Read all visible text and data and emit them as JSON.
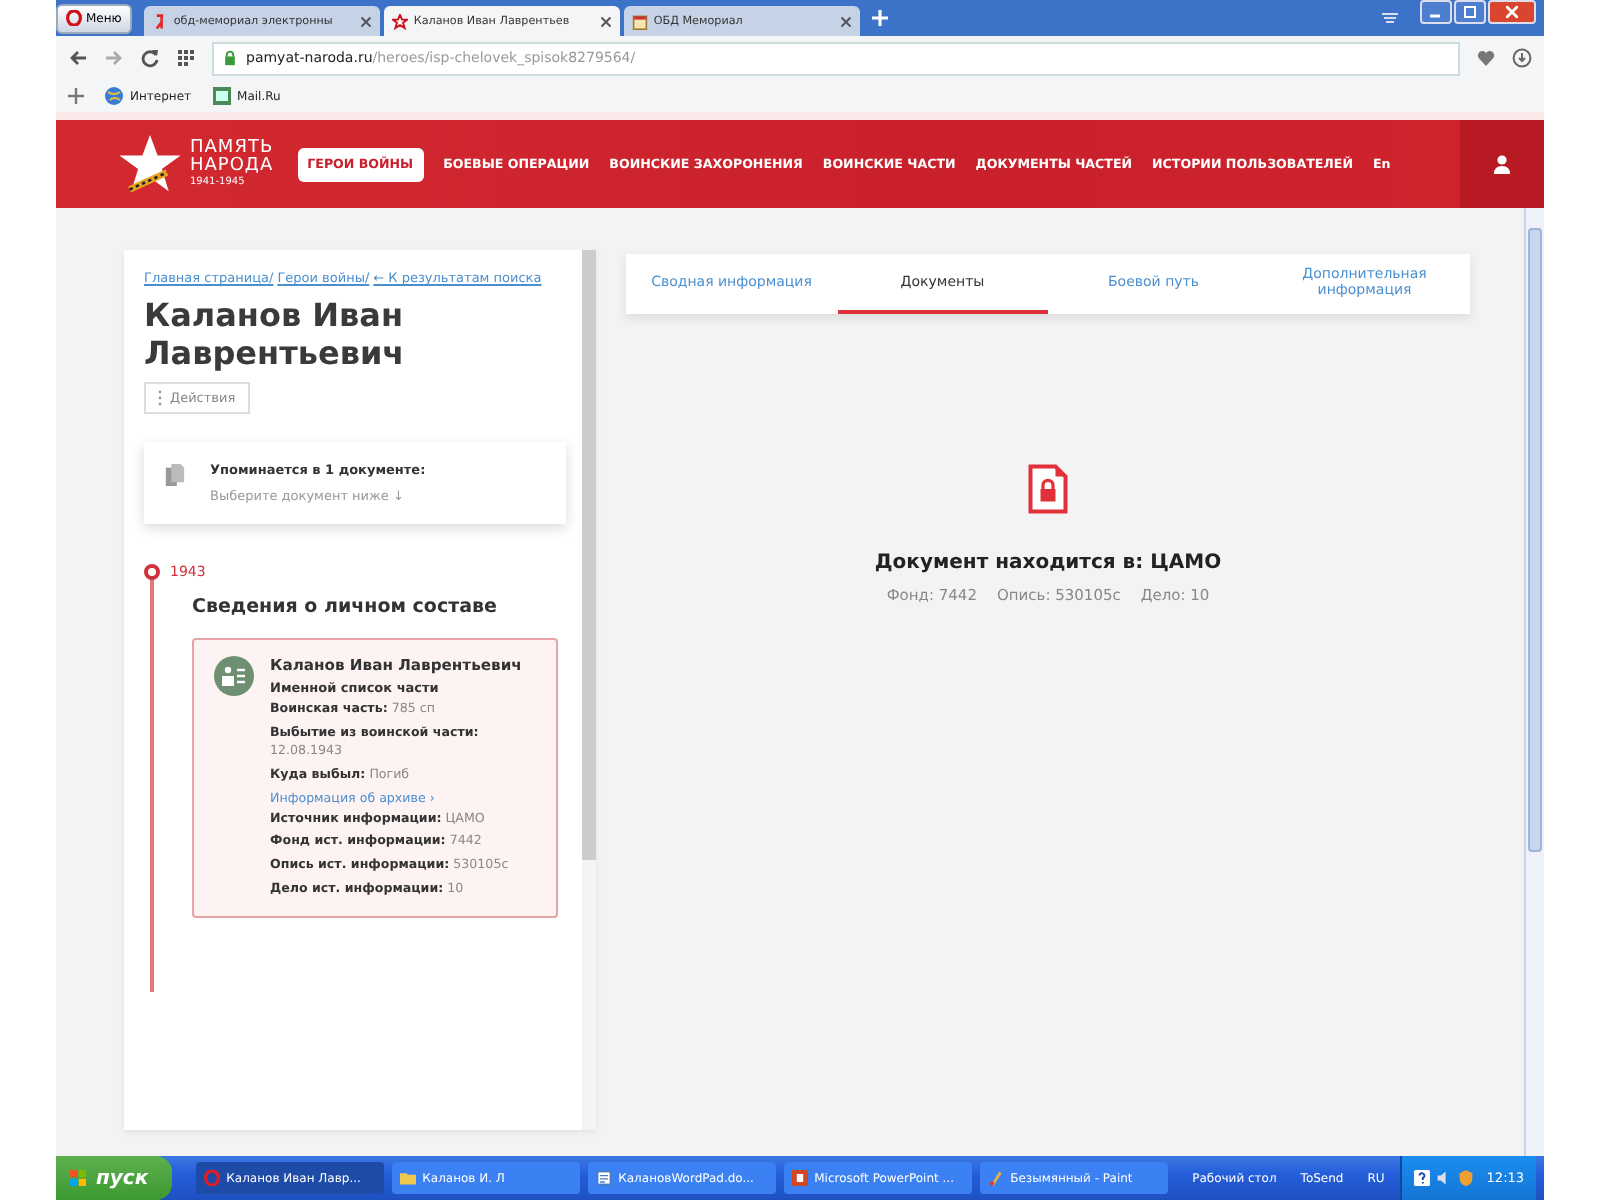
{
  "browser": {
    "menu_label": "Меню",
    "tabs": [
      {
        "title": "обд-мемориал электронны",
        "selected": false
      },
      {
        "title": "Каланов Иван Лаврентьев",
        "selected": true
      },
      {
        "title": "ОБД Мемориал",
        "selected": false
      }
    ],
    "url_host": "pamyat-naroda.ru",
    "url_path": "/heroes/isp-chelovek_spisok8279564/",
    "bookmarks": [
      {
        "label": "Интернет"
      },
      {
        "label": "Mail.Ru"
      }
    ]
  },
  "site_header": {
    "logo": [
      "ПАМЯТЬ",
      "НАРОДА",
      "1941-1945"
    ],
    "nav": [
      {
        "label": "ГЕРОИ ВОЙНЫ",
        "selected": true
      },
      {
        "label": "БОЕВЫЕ ОПЕРАЦИИ",
        "selected": false
      },
      {
        "label": "ВОИНСКИЕ ЗАХОРОНЕНИЯ",
        "selected": false
      },
      {
        "label": "ВОИНСКИЕ ЧАСТИ",
        "selected": false
      },
      {
        "label": "ДОКУМЕНТЫ ЧАСТЕЙ",
        "selected": false
      },
      {
        "label": "ИСТОРИИ ПОЛЬЗОВАТЕЛЕЙ",
        "selected": false
      }
    ],
    "language": "En"
  },
  "person": {
    "breadcrumbs": [
      "Главная страница/",
      "Герои войны/",
      "← К результатам поиска"
    ],
    "name": "Каланов Иван Лаврентьевич",
    "actions": "Действия",
    "mention": {
      "title": "Упоминается в 1 документе:",
      "hint": "Выберите документ ниже ↓"
    },
    "timeline": {
      "year": "1943",
      "section": "Сведения о личном составе",
      "record": {
        "name": "Каланов Иван Лаврентьевич",
        "type": "Именной список части",
        "fields": [
          {
            "kind": "field",
            "label": "Воинская часть:",
            "value": "785 сп"
          },
          {
            "kind": "field",
            "label": "Выбытие из воинской части:",
            "value": "12.08.1943"
          },
          {
            "kind": "field",
            "label": "Куда выбыл:",
            "value": "Погиб"
          },
          {
            "kind": "link",
            "label": "Информация об архиве ›"
          },
          {
            "kind": "field",
            "label": "Источник информации:",
            "value": "ЦАМО"
          },
          {
            "kind": "field",
            "label": "Фонд ист. информации:",
            "value": "7442"
          },
          {
            "kind": "field",
            "label": "Опись ист. информации:",
            "value": "530105с"
          },
          {
            "kind": "field",
            "label": "Дело ист. информации:",
            "value": "10"
          }
        ]
      }
    }
  },
  "tabs": [
    {
      "label": "Сводная информация",
      "selected": false
    },
    {
      "label": "Документы",
      "selected": true
    },
    {
      "label": "Боевой путь",
      "selected": false
    },
    {
      "label": "Дополнительная информация",
      "selected": false
    }
  ],
  "document": {
    "location": "Документ находится в: ЦАМО",
    "details": [
      "Фонд: 7442",
      "Опись: 530105с",
      "Дело: 10"
    ]
  },
  "taskbar": {
    "start": "пуск",
    "tasks": [
      {
        "label": "Каланов Иван Лавр...",
        "selected": true
      },
      {
        "label": "Каланов И. Л",
        "selected": false
      },
      {
        "label": "КалановWordPad.do...",
        "selected": false
      },
      {
        "label": "Microsoft PowerPoint ...",
        "selected": false
      },
      {
        "label": "Безымянный - Paint",
        "selected": false
      }
    ],
    "tray": [
      "Рабочий стол",
      "ToSend",
      "RU"
    ],
    "time": "12:13"
  }
}
